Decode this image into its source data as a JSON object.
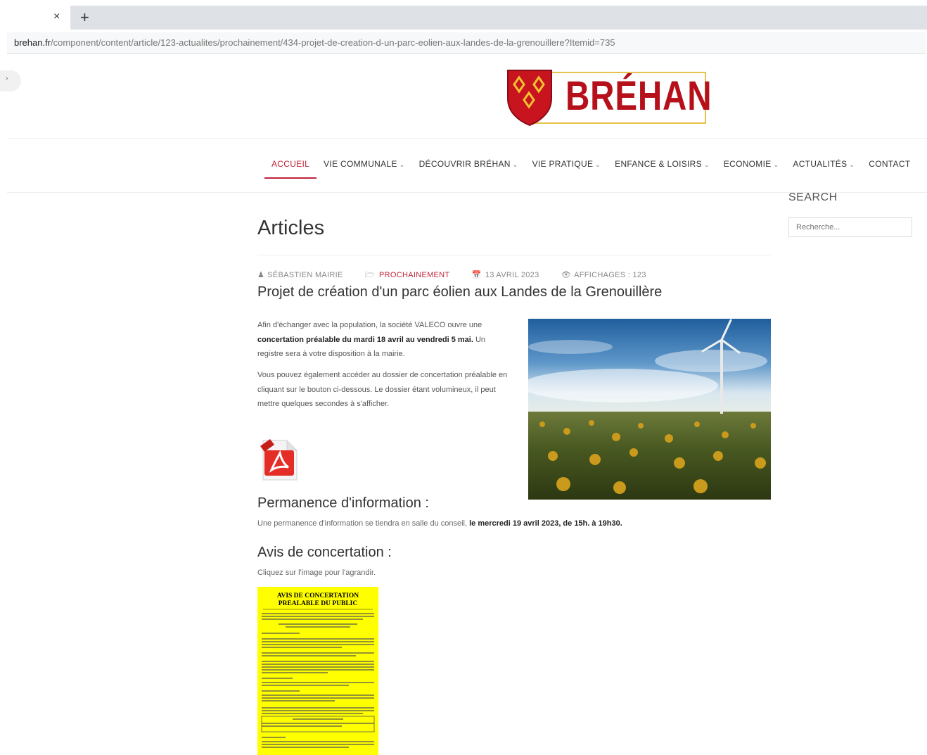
{
  "browser": {
    "url_domain": "brehan.fr",
    "url_path": "/component/content/article/123-actualites/prochainement/434-projet-de-creation-d-un-parc-eolien-aux-landes-de-la-grenouillere?Itemid=735",
    "tab_close": "×",
    "new_tab": "+"
  },
  "site": {
    "logo_text": "BRÉHAN"
  },
  "nav": {
    "items": [
      {
        "label": "ACCUEIL"
      },
      {
        "label": "VIE COMMUNALE"
      },
      {
        "label": "DÉCOUVRIR BRÉHAN"
      },
      {
        "label": "VIE PRATIQUE"
      },
      {
        "label": "ENFANCE & LOISIRS"
      },
      {
        "label": "ECONOMIE"
      },
      {
        "label": "ACTUALITÉS"
      },
      {
        "label": "CONTACT"
      }
    ],
    "chevron": "⌄"
  },
  "search": {
    "title": "SEARCH",
    "placeholder": "Recherche..."
  },
  "page": {
    "title": "Articles"
  },
  "meta": {
    "author": "SÉBASTIEN MAIRIE",
    "category": "PROCHAINEMENT",
    "date": "13 AVRIL 2023",
    "hits": "AFFICHAGES : 123"
  },
  "article": {
    "title": "Projet de création d'un parc éolien aux Landes de la Grenouillère",
    "p1_a": "Afin d'échanger avec la population, la société VALECO ouvre une ",
    "p1_bold": "concertation préalable du mardi 18 avril au vendredi 5 mai.",
    "p1_b": " Un registre sera à votre disposition à la mairie.",
    "p2": "Vous pouvez également accéder au dossier de concertation préalable en cliquant sur le bouton ci-dessous. Le dossier étant volumineux, il peut mettre quelques secondes à s'afficher.",
    "h_permanence": "Permanence d'information :",
    "permanence_a": "Une permanence d'information se tiendra en salle du conseil, ",
    "permanence_bold": "le mercredi 19 avril 2023, de 15h. à 19h30.",
    "h_avis": "Avis de concertation :",
    "avis_text": "Cliquez sur l'image pour l'agrandir.",
    "poster_title_1": "AVIS DE CONCERTATION",
    "poster_title_2": "PREALABLE DU PUBLIC"
  },
  "colors": {
    "accent": "#c0243a",
    "poster": "#ffff00",
    "logo_red": "#b6101b",
    "logo_gold": "#e7c24a"
  }
}
